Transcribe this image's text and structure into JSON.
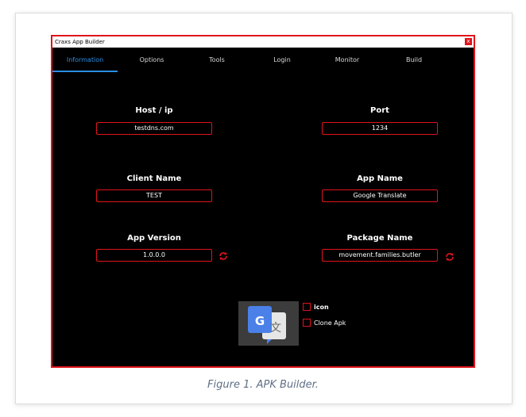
{
  "window": {
    "title": "Craxs App Builder",
    "close_label": "x"
  },
  "tabs": [
    {
      "label": "Information",
      "active": true
    },
    {
      "label": "Options",
      "active": false
    },
    {
      "label": "Tools",
      "active": false
    },
    {
      "label": "Login",
      "active": false
    },
    {
      "label": "Monitor",
      "active": false
    },
    {
      "label": "Build",
      "active": false
    }
  ],
  "fields": {
    "host": {
      "label": "Host / ip",
      "value": "testdns.com"
    },
    "port": {
      "label": "Port",
      "value": "1234"
    },
    "client_name": {
      "label": "Client Name",
      "value": "TEST"
    },
    "app_name": {
      "label": "App Name",
      "value": "Google Translate"
    },
    "app_version": {
      "label": "App Version",
      "value": "1.0.0.0"
    },
    "package_name": {
      "label": "Package Name",
      "value": "movement.families.butler"
    }
  },
  "icons": {
    "refresh": "refresh-icon",
    "app": "google-translate-app-icon"
  },
  "options": {
    "icon": {
      "label": "icon",
      "checked": false
    },
    "clone_apk": {
      "label": "Clone Apk",
      "checked": false
    }
  },
  "caption": "Figure 1. APK Builder.",
  "colors": {
    "accent_red": "#e0141c",
    "tab_active": "#2b8fe6",
    "background": "#000000"
  }
}
